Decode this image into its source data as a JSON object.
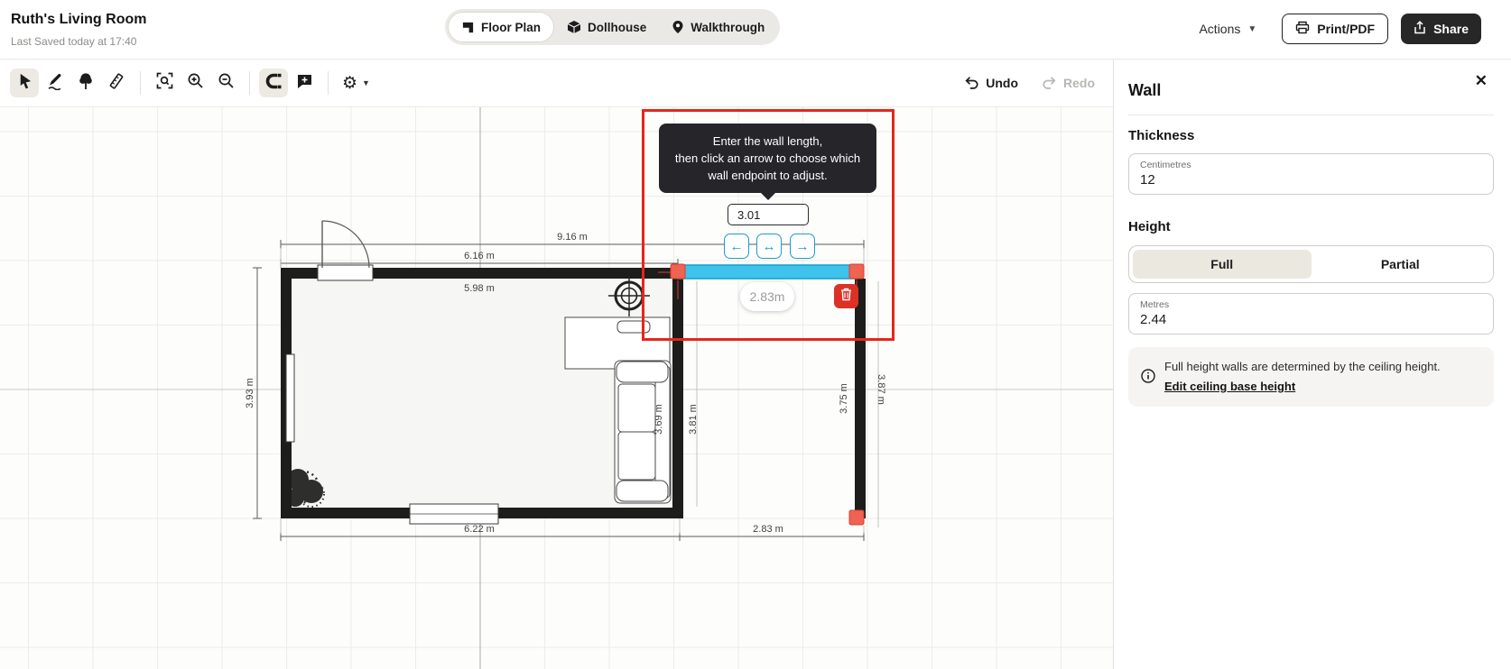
{
  "header": {
    "title": "Ruth's Living Room",
    "subtitle": "Last Saved today at 17:40",
    "tabs": [
      {
        "label": "Floor Plan",
        "icon": "floor-plan-icon",
        "selected": true
      },
      {
        "label": "Dollhouse",
        "icon": "dollhouse-icon",
        "selected": false
      },
      {
        "label": "Walkthrough",
        "icon": "walkthrough-icon",
        "selected": false
      }
    ],
    "actions_label": "Actions",
    "print_label": "Print/PDF",
    "share_label": "Share"
  },
  "toolbar": {
    "tools": [
      "select-tool",
      "draw-walls-tool",
      "furniture-tool",
      "measure-tool",
      "zoom-to-fit",
      "zoom-in",
      "zoom-out",
      "magnet-snap-tool",
      "annotation-tool",
      "settings-tool"
    ],
    "selected_tools": [
      "select-tool",
      "magnet-snap-tool"
    ],
    "undo_label": "Undo",
    "redo_label": "Redo"
  },
  "canvas": {
    "tooltip": {
      "line1": "Enter the wall length,",
      "line2": "then click an arrow to choose which",
      "line3": "wall endpoint to adjust."
    },
    "length_input": "3.01",
    "selected_wall_label": "2.83m",
    "dimensions": {
      "total_width": "9.16 m",
      "left_room_width": "6.16 m",
      "left_room_inner_width": "5.98 m",
      "left_height": "3.93 m",
      "bottom_left": "6.22 m",
      "bottom_right": "2.83 m",
      "inner_left": "3.69 m",
      "inner_right": "3.81 m",
      "right_wall_inner": "3.75 m",
      "right_wall_outer": "3.87 m"
    },
    "colors": {
      "selected_wall": "#3fc2ec",
      "endpoint_handle": "#ee6352",
      "annotation_red": "#e5261b",
      "delete_red": "#dd3125",
      "accent_teal": "#1b9ec6"
    }
  },
  "panel": {
    "title": "Wall",
    "thickness": {
      "heading": "Thickness",
      "unit_label": "Centimetres",
      "value": "12"
    },
    "height": {
      "heading": "Height",
      "options": [
        {
          "label": "Full",
          "selected": true
        },
        {
          "label": "Partial",
          "selected": false
        }
      ],
      "unit_label": "Metres",
      "value": "2.44"
    },
    "info": {
      "text": "Full height walls are determined by the ceiling height.",
      "link": "Edit ceiling base height"
    }
  }
}
